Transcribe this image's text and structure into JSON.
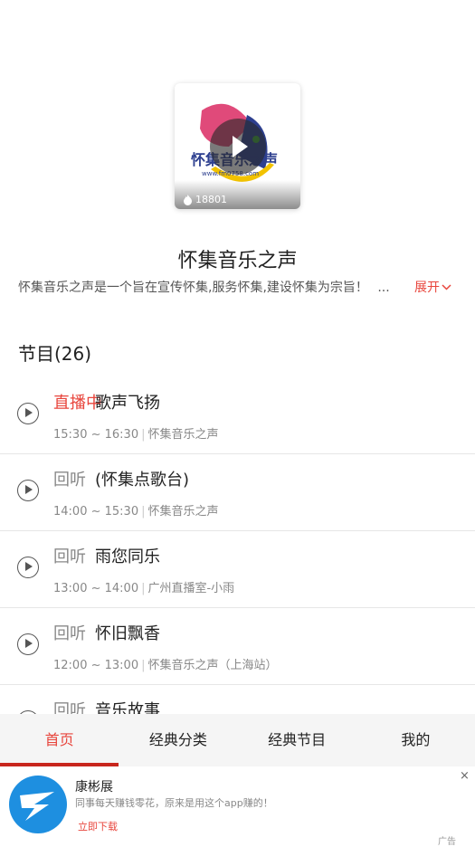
{
  "cover": {
    "logo_text": "怀集音乐之声",
    "logo_url": "www.fm0758.com",
    "listen_count": "18801"
  },
  "station": {
    "title": "怀集音乐之声",
    "description": "怀集音乐之声是一个旨在宣传怀集,服务怀集,建设怀集为宗旨！",
    "ellipsis": "...",
    "expand_label": "展开"
  },
  "programs": {
    "section_title": "节目(26)",
    "items": [
      {
        "status": "直播中",
        "name": "歌声飞扬",
        "time": "15:30 ~ 16:30",
        "host": "怀集音乐之声"
      },
      {
        "status": "回听",
        "name": "(怀集点歌台)",
        "time": "14:00 ~ 15:30",
        "host": "怀集音乐之声"
      },
      {
        "status": "回听",
        "name": "雨您同乐",
        "time": "13:00 ~ 14:00",
        "host": "广州直播室-小雨"
      },
      {
        "status": "回听",
        "name": "怀旧飘香",
        "time": "12:00 ~ 13:00",
        "host": "怀集音乐之声（上海站）"
      },
      {
        "status": "回听",
        "name": "音乐故事",
        "time": "",
        "host": ""
      }
    ]
  },
  "tabs": [
    "首页",
    "经典分类",
    "经典节目",
    "我的"
  ],
  "ad": {
    "name": "康彬展",
    "text": "同事每天赚钱零花，原来是用这个app赚的！",
    "cta": "立即下载",
    "close": "×",
    "tag": "广告"
  },
  "colors": {
    "accent": "#e8453c",
    "tab_indicator": "#c8261d"
  }
}
